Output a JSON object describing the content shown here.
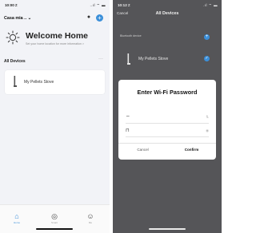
{
  "left": {
    "status": {
      "time": "10:00 ≠",
      "icons": "..ıl ⌔ ▬"
    },
    "home_selector": "Casa mia .. ⌄",
    "welcome_title": "Welcome Home",
    "welcome_subtitle": "Set your home location for more information >",
    "section_label": "All Devices",
    "more_glyph": "···",
    "device_name": "My Pellets Stove",
    "tabs": [
      {
        "icon": "house-icon",
        "glyph": "⌂",
        "label": "Home"
      },
      {
        "icon": "smart-icon",
        "glyph": "◎",
        "label": "Smart"
      },
      {
        "icon": "me-icon",
        "glyph": "☺",
        "label": "Me"
      }
    ],
    "accent": "#3b8fd9"
  },
  "right": {
    "status": {
      "time": "10:12 ≠",
      "icons": ".ıl ⌔ ▬"
    },
    "cancel_label": "Cancel",
    "title": "All Devices",
    "bluetooth_label": "Bluetooth device",
    "device_name": "My Pellets Stove",
    "modal": {
      "title": "Enter Wi-Fi Password",
      "wifi_glyph": "⌔",
      "lock_glyph": "⊓",
      "aux1": "⇅",
      "aux2": "◉",
      "cancel": "Cancel",
      "confirm": "Confirm"
    }
  }
}
